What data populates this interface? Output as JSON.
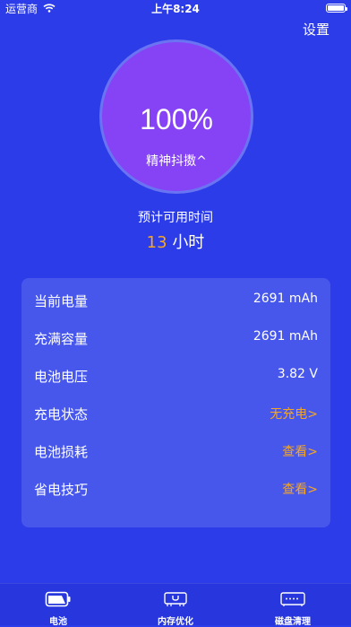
{
  "status_bar": {
    "carrier": "运营商",
    "time": "上午8:24",
    "battery_level": 1.0
  },
  "header": {
    "settings_label": "设置"
  },
  "gauge": {
    "percent_text": "100%",
    "status_text": "精神抖擞^"
  },
  "estimate": {
    "label": "预计可用时间",
    "value": "13",
    "unit": "小时"
  },
  "info_card": {
    "rows": [
      {
        "label": "当前电量",
        "value": "2691 mAh",
        "accent": false
      },
      {
        "label": "充满容量",
        "value": "2691 mAh",
        "accent": false
      },
      {
        "label": "电池电压",
        "value": "3.82 V",
        "accent": false
      },
      {
        "label": "充电状态",
        "value": "无充电>",
        "accent": true
      },
      {
        "label": "电池损耗",
        "value": "查看>",
        "accent": true
      },
      {
        "label": "省电技巧",
        "value": "查看>",
        "accent": true
      }
    ]
  },
  "tab_bar": {
    "tabs": [
      {
        "label": "电池",
        "icon": "battery-icon"
      },
      {
        "label": "内存优化",
        "icon": "memory-icon"
      },
      {
        "label": "磁盘清理",
        "icon": "disk-icon"
      }
    ]
  },
  "colors": {
    "background": "#2c3ce8",
    "gauge_fill": "#8543f5",
    "card": "#4757ec",
    "accent": "#f5a623"
  }
}
